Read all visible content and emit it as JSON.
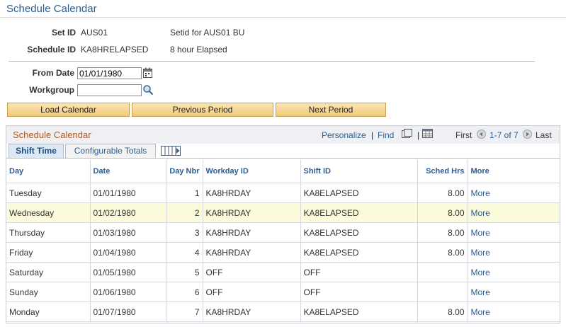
{
  "page": {
    "title": "Schedule Calendar"
  },
  "header": {
    "setid_label": "Set ID",
    "setid_value": "AUS01",
    "setid_desc": "Setid for AUS01 BU",
    "schedid_label": "Schedule ID",
    "schedid_value": "KA8HRELAPSED",
    "schedid_desc": "8 hour Elapsed"
  },
  "filters": {
    "from_date_label": "From Date",
    "from_date_value": "01/01/1980",
    "workgroup_label": "Workgroup",
    "workgroup_value": ""
  },
  "buttons": {
    "load": "Load Calendar",
    "prev": "Previous Period",
    "next": "Next Period"
  },
  "grid": {
    "title": "Schedule Calendar",
    "personalize": "Personalize",
    "pipe": "|",
    "find": "Find",
    "first": "First",
    "range": "1-7 of 7",
    "last": "Last",
    "tabs": [
      {
        "label": "Shift Time"
      },
      {
        "label": "Configurable Totals"
      }
    ],
    "columns": [
      "Day",
      "Date",
      "Day Nbr",
      "Workday ID",
      "Shift ID",
      "Sched Hrs",
      "More"
    ],
    "rows": [
      {
        "day": "Tuesday",
        "date": "01/01/1980",
        "nbr": "1",
        "workday": "KA8HRDAY",
        "shift": "KA8ELAPSED",
        "hrs": "8.00",
        "more": "More"
      },
      {
        "day": "Wednesday",
        "date": "01/02/1980",
        "nbr": "2",
        "workday": "KA8HRDAY",
        "shift": "KA8ELAPSED",
        "hrs": "8.00",
        "more": "More"
      },
      {
        "day": "Thursday",
        "date": "01/03/1980",
        "nbr": "3",
        "workday": "KA8HRDAY",
        "shift": "KA8ELAPSED",
        "hrs": "8.00",
        "more": "More"
      },
      {
        "day": "Friday",
        "date": "01/04/1980",
        "nbr": "4",
        "workday": "KA8HRDAY",
        "shift": "KA8ELAPSED",
        "hrs": "8.00",
        "more": "More"
      },
      {
        "day": "Saturday",
        "date": "01/05/1980",
        "nbr": "5",
        "workday": "OFF",
        "shift": "OFF",
        "hrs": "",
        "more": "More"
      },
      {
        "day": "Sunday",
        "date": "01/06/1980",
        "nbr": "6",
        "workday": "OFF",
        "shift": "OFF",
        "hrs": "",
        "more": "More"
      },
      {
        "day": "Monday",
        "date": "01/07/1980",
        "nbr": "7",
        "workday": "KA8HRDAY",
        "shift": "KA8ELAPSED",
        "hrs": "8.00",
        "more": "More"
      }
    ]
  },
  "colors": {
    "link": "#2d5d91",
    "grid_title": "#b45a1c",
    "button_top": "#fbe6b4",
    "button_bottom": "#f1c87a",
    "highlight_row": "#fbfbdc"
  }
}
